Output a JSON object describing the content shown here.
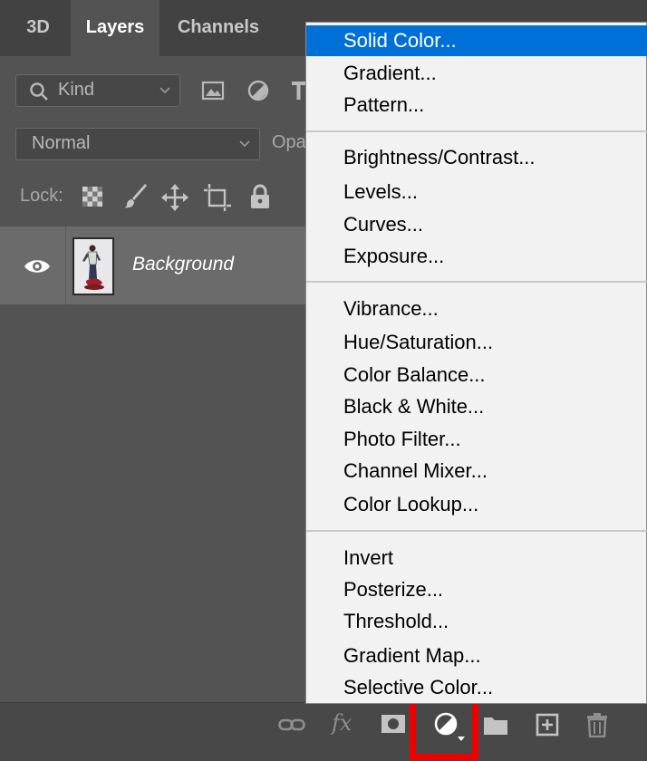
{
  "tabs": [
    {
      "label": "3D"
    },
    {
      "label": "Layers"
    },
    {
      "label": "Channels"
    }
  ],
  "filter": {
    "label": "Kind"
  },
  "blend_mode": {
    "value": "Normal",
    "opacity_label": "Opa"
  },
  "lock": {
    "label": "Lock:"
  },
  "layer": {
    "name": "Background"
  },
  "menu": {
    "items": [
      {
        "label": "Solid Color..."
      },
      {
        "label": "Gradient..."
      },
      {
        "label": "Pattern..."
      },
      {
        "label": "Brightness/Contrast..."
      },
      {
        "label": "Levels..."
      },
      {
        "label": "Curves..."
      },
      {
        "label": "Exposure..."
      },
      {
        "label": "Vibrance..."
      },
      {
        "label": "Hue/Saturation..."
      },
      {
        "label": "Color Balance..."
      },
      {
        "label": "Black & White..."
      },
      {
        "label": "Photo Filter..."
      },
      {
        "label": "Channel Mixer..."
      },
      {
        "label": "Color Lookup..."
      },
      {
        "label": "Invert"
      },
      {
        "label": "Posterize..."
      },
      {
        "label": "Threshold..."
      },
      {
        "label": "Gradient Map..."
      },
      {
        "label": "Selective Color..."
      }
    ]
  },
  "bottom_bar": {
    "fx_label": "fx"
  },
  "colors": {
    "menu_highlight": "#0070d7",
    "callout_border": "#ee0000",
    "panel_bg": "#535353"
  }
}
